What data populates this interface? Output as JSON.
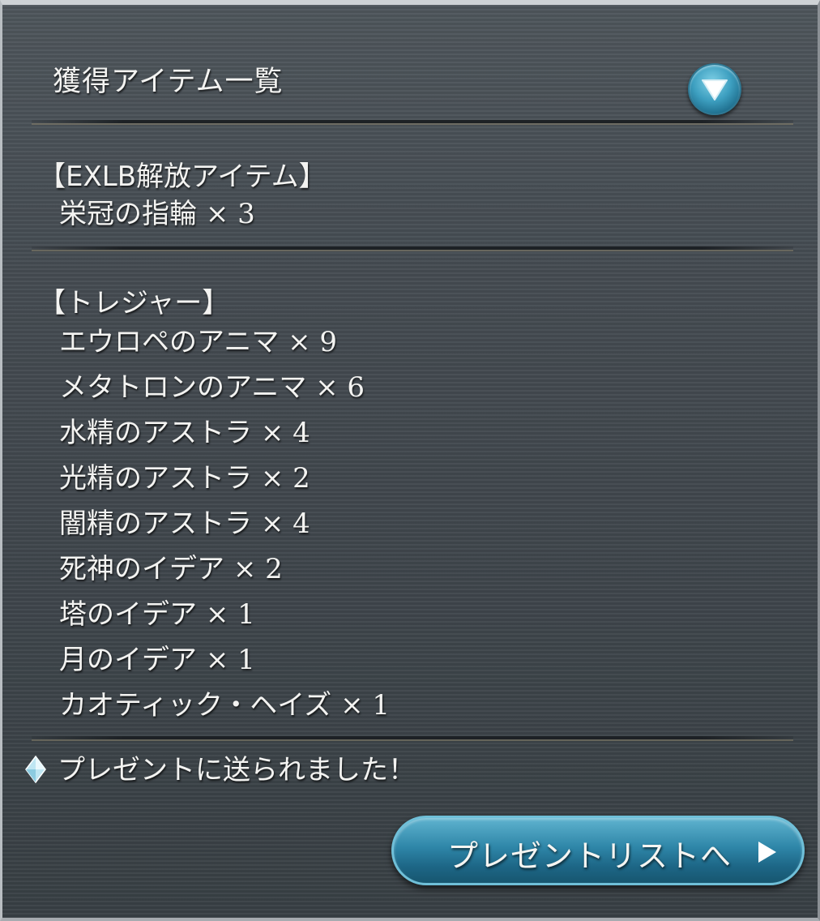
{
  "header": {
    "title": "獲得アイテム一覧",
    "collapse_icon": "chevron-down-icon"
  },
  "sections": [
    {
      "header": "【EXLB解放アイテム】",
      "items": [
        {
          "name": "栄冠の指輪",
          "qty": "× 3"
        }
      ]
    },
    {
      "header": "【トレジャー】",
      "items": [
        {
          "name": "エウロペのアニマ",
          "qty": "× 9"
        },
        {
          "name": "メタトロンのアニマ",
          "qty": "× 6"
        },
        {
          "name": "水精のアストラ",
          "qty": "× 4"
        },
        {
          "name": "光精のアストラ",
          "qty": "× 2"
        },
        {
          "name": "闇精のアストラ",
          "qty": "× 4"
        },
        {
          "name": "死神のイデア",
          "qty": "× 2"
        },
        {
          "name": "塔のイデア",
          "qty": "× 1"
        },
        {
          "name": "月のイデア",
          "qty": "× 1"
        },
        {
          "name": "カオティック・ヘイズ",
          "qty": "× 1"
        }
      ]
    }
  ],
  "notice": {
    "icon": "gem-icon",
    "text": "プレゼントに送られました！"
  },
  "present_button": {
    "label": "プレゼントリストへ",
    "icon": "play-arrow-icon"
  },
  "colors": {
    "panel_bg": "#454c52",
    "accent_button": "#2e86a8",
    "text": "#f3f3f1"
  }
}
